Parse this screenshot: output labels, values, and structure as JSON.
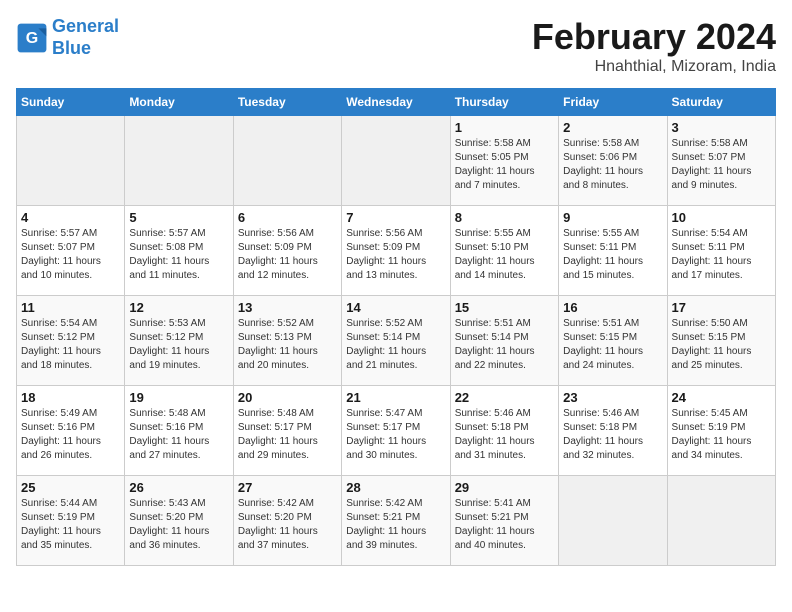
{
  "header": {
    "logo_line1": "General",
    "logo_line2": "Blue",
    "month_title": "February 2024",
    "subtitle": "Hnahthial, Mizoram, India"
  },
  "weekdays": [
    "Sunday",
    "Monday",
    "Tuesday",
    "Wednesday",
    "Thursday",
    "Friday",
    "Saturday"
  ],
  "weeks": [
    [
      {
        "day": "",
        "detail": ""
      },
      {
        "day": "",
        "detail": ""
      },
      {
        "day": "",
        "detail": ""
      },
      {
        "day": "",
        "detail": ""
      },
      {
        "day": "1",
        "detail": "Sunrise: 5:58 AM\nSunset: 5:05 PM\nDaylight: 11 hours\nand 7 minutes."
      },
      {
        "day": "2",
        "detail": "Sunrise: 5:58 AM\nSunset: 5:06 PM\nDaylight: 11 hours\nand 8 minutes."
      },
      {
        "day": "3",
        "detail": "Sunrise: 5:58 AM\nSunset: 5:07 PM\nDaylight: 11 hours\nand 9 minutes."
      }
    ],
    [
      {
        "day": "4",
        "detail": "Sunrise: 5:57 AM\nSunset: 5:07 PM\nDaylight: 11 hours\nand 10 minutes."
      },
      {
        "day": "5",
        "detail": "Sunrise: 5:57 AM\nSunset: 5:08 PM\nDaylight: 11 hours\nand 11 minutes."
      },
      {
        "day": "6",
        "detail": "Sunrise: 5:56 AM\nSunset: 5:09 PM\nDaylight: 11 hours\nand 12 minutes."
      },
      {
        "day": "7",
        "detail": "Sunrise: 5:56 AM\nSunset: 5:09 PM\nDaylight: 11 hours\nand 13 minutes."
      },
      {
        "day": "8",
        "detail": "Sunrise: 5:55 AM\nSunset: 5:10 PM\nDaylight: 11 hours\nand 14 minutes."
      },
      {
        "day": "9",
        "detail": "Sunrise: 5:55 AM\nSunset: 5:11 PM\nDaylight: 11 hours\nand 15 minutes."
      },
      {
        "day": "10",
        "detail": "Sunrise: 5:54 AM\nSunset: 5:11 PM\nDaylight: 11 hours\nand 17 minutes."
      }
    ],
    [
      {
        "day": "11",
        "detail": "Sunrise: 5:54 AM\nSunset: 5:12 PM\nDaylight: 11 hours\nand 18 minutes."
      },
      {
        "day": "12",
        "detail": "Sunrise: 5:53 AM\nSunset: 5:12 PM\nDaylight: 11 hours\nand 19 minutes."
      },
      {
        "day": "13",
        "detail": "Sunrise: 5:52 AM\nSunset: 5:13 PM\nDaylight: 11 hours\nand 20 minutes."
      },
      {
        "day": "14",
        "detail": "Sunrise: 5:52 AM\nSunset: 5:14 PM\nDaylight: 11 hours\nand 21 minutes."
      },
      {
        "day": "15",
        "detail": "Sunrise: 5:51 AM\nSunset: 5:14 PM\nDaylight: 11 hours\nand 22 minutes."
      },
      {
        "day": "16",
        "detail": "Sunrise: 5:51 AM\nSunset: 5:15 PM\nDaylight: 11 hours\nand 24 minutes."
      },
      {
        "day": "17",
        "detail": "Sunrise: 5:50 AM\nSunset: 5:15 PM\nDaylight: 11 hours\nand 25 minutes."
      }
    ],
    [
      {
        "day": "18",
        "detail": "Sunrise: 5:49 AM\nSunset: 5:16 PM\nDaylight: 11 hours\nand 26 minutes."
      },
      {
        "day": "19",
        "detail": "Sunrise: 5:48 AM\nSunset: 5:16 PM\nDaylight: 11 hours\nand 27 minutes."
      },
      {
        "day": "20",
        "detail": "Sunrise: 5:48 AM\nSunset: 5:17 PM\nDaylight: 11 hours\nand 29 minutes."
      },
      {
        "day": "21",
        "detail": "Sunrise: 5:47 AM\nSunset: 5:17 PM\nDaylight: 11 hours\nand 30 minutes."
      },
      {
        "day": "22",
        "detail": "Sunrise: 5:46 AM\nSunset: 5:18 PM\nDaylight: 11 hours\nand 31 minutes."
      },
      {
        "day": "23",
        "detail": "Sunrise: 5:46 AM\nSunset: 5:18 PM\nDaylight: 11 hours\nand 32 minutes."
      },
      {
        "day": "24",
        "detail": "Sunrise: 5:45 AM\nSunset: 5:19 PM\nDaylight: 11 hours\nand 34 minutes."
      }
    ],
    [
      {
        "day": "25",
        "detail": "Sunrise: 5:44 AM\nSunset: 5:19 PM\nDaylight: 11 hours\nand 35 minutes."
      },
      {
        "day": "26",
        "detail": "Sunrise: 5:43 AM\nSunset: 5:20 PM\nDaylight: 11 hours\nand 36 minutes."
      },
      {
        "day": "27",
        "detail": "Sunrise: 5:42 AM\nSunset: 5:20 PM\nDaylight: 11 hours\nand 37 minutes."
      },
      {
        "day": "28",
        "detail": "Sunrise: 5:42 AM\nSunset: 5:21 PM\nDaylight: 11 hours\nand 39 minutes."
      },
      {
        "day": "29",
        "detail": "Sunrise: 5:41 AM\nSunset: 5:21 PM\nDaylight: 11 hours\nand 40 minutes."
      },
      {
        "day": "",
        "detail": ""
      },
      {
        "day": "",
        "detail": ""
      }
    ]
  ]
}
